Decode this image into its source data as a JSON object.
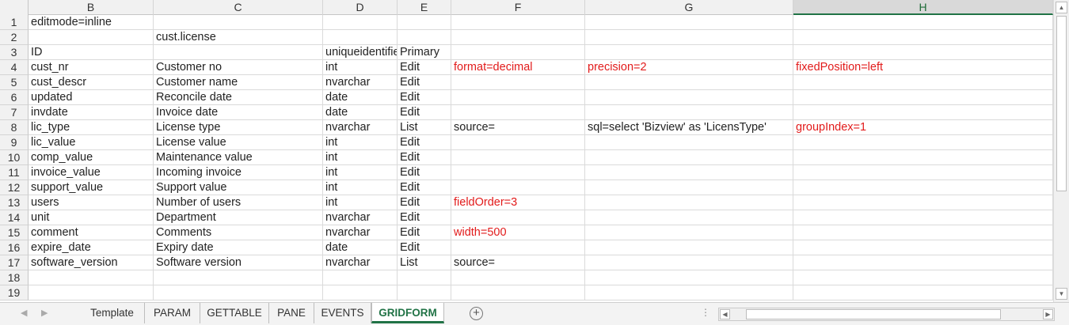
{
  "columns": [
    "B",
    "C",
    "D",
    "E",
    "F",
    "G",
    "H"
  ],
  "selected_column": "H",
  "rows": [
    {
      "n": "1",
      "B": "editmode=inline",
      "C": "",
      "D": "",
      "E": "",
      "F": "",
      "G": "",
      "H": ""
    },
    {
      "n": "2",
      "B": "",
      "C": "cust.license",
      "D": "",
      "E": "",
      "F": "",
      "G": "",
      "H": ""
    },
    {
      "n": "3",
      "B": "ID",
      "C": "",
      "D": "uniqueidentifier",
      "E": "Primary",
      "F": "",
      "G": "",
      "H": ""
    },
    {
      "n": "4",
      "B": "cust_nr",
      "C": "Customer no",
      "D": "int",
      "E": "Edit",
      "F": "format=decimal",
      "G": "precision=2",
      "H": "fixedPosition=left"
    },
    {
      "n": "5",
      "B": "cust_descr",
      "C": "Customer name",
      "D": "nvarchar",
      "E": "Edit",
      "F": "",
      "G": "",
      "H": ""
    },
    {
      "n": "6",
      "B": "updated",
      "C": "Reconcile date",
      "D": "date",
      "E": "Edit",
      "F": "",
      "G": "",
      "H": ""
    },
    {
      "n": "7",
      "B": "invdate",
      "C": "Invoice date",
      "D": "date",
      "E": "Edit",
      "F": "",
      "G": "",
      "H": ""
    },
    {
      "n": "8",
      "B": "lic_type",
      "C": "License type",
      "D": "nvarchar",
      "E": "List",
      "F": "source=",
      "G": "sql=select 'Bizview' as 'LicensType'",
      "H": "groupIndex=1"
    },
    {
      "n": "9",
      "B": "lic_value",
      "C": "License value",
      "D": "int",
      "E": "Edit",
      "F": "",
      "G": "",
      "H": ""
    },
    {
      "n": "10",
      "B": "comp_value",
      "C": "Maintenance value",
      "D": "int",
      "E": "Edit",
      "F": "",
      "G": "",
      "H": ""
    },
    {
      "n": "11",
      "B": "invoice_value",
      "C": "Incoming invoice",
      "D": "int",
      "E": "Edit",
      "F": "",
      "G": "",
      "H": ""
    },
    {
      "n": "12",
      "B": "support_value",
      "C": "Support value",
      "D": "int",
      "E": "Edit",
      "F": "",
      "G": "",
      "H": ""
    },
    {
      "n": "13",
      "B": "users",
      "C": "Number of users",
      "D": "int",
      "E": "Edit",
      "F": "fieldOrder=3",
      "G": "",
      "H": ""
    },
    {
      "n": "14",
      "B": "unit",
      "C": "Department",
      "D": "nvarchar",
      "E": "Edit",
      "F": "",
      "G": "",
      "H": ""
    },
    {
      "n": "15",
      "B": "comment",
      "C": "Comments",
      "D": "nvarchar",
      "E": "Edit",
      "F": "width=500",
      "G": "",
      "H": ""
    },
    {
      "n": "16",
      "B": "expire_date",
      "C": "Expiry date",
      "D": "date",
      "E": "Edit",
      "F": "",
      "G": "",
      "H": ""
    },
    {
      "n": "17",
      "B": "software_version",
      "C": "Software version",
      "D": "nvarchar",
      "E": "List",
      "F": "source=",
      "G": "",
      "H": ""
    },
    {
      "n": "18",
      "B": "",
      "C": "",
      "D": "",
      "E": "",
      "F": "",
      "G": "",
      "H": ""
    },
    {
      "n": "19",
      "B": "",
      "C": "",
      "D": "",
      "E": "",
      "F": "",
      "G": "",
      "H": ""
    }
  ],
  "red_cells": [
    "4F",
    "4G",
    "4H",
    "8H",
    "13F",
    "15F"
  ],
  "sheet_tabs": [
    "Template",
    "PARAM",
    "GETTABLE",
    "PANE",
    "EVENTS",
    "GRIDFORM"
  ],
  "active_tab": "GRIDFORM",
  "colors": {
    "accent": "#217346",
    "highlight_text": "#e21b1b"
  },
  "icons": {
    "add_sheet": "plus-circle-icon",
    "nav_prev": "triangle-left-icon",
    "nav_next": "triangle-right-icon"
  }
}
